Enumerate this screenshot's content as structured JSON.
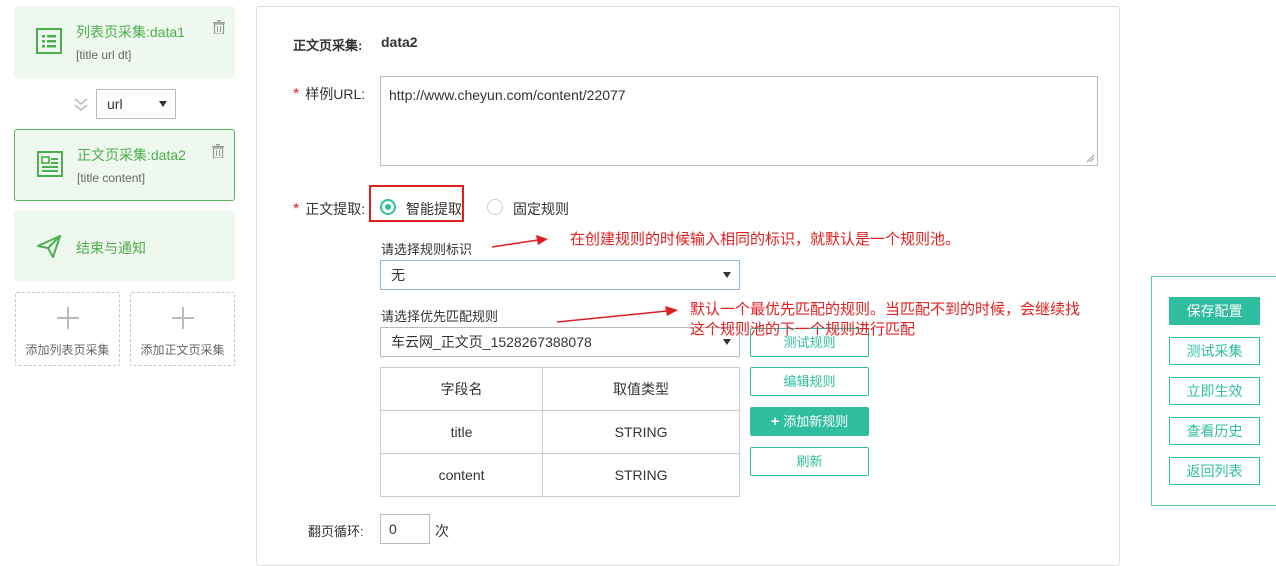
{
  "left_panel": {
    "step1": {
      "title": "列表页采集:data1",
      "sub": "[title url dt]"
    },
    "connector": {
      "selected": "url"
    },
    "step2": {
      "title": "正文页采集:data2",
      "sub": "[title content]"
    },
    "step3": {
      "title": "结束与通知"
    },
    "add_list": "添加列表页采集",
    "add_content": "添加正文页采集"
  },
  "form": {
    "header_label": "正文页采集:",
    "header_value": "data2",
    "req_mark": "*",
    "url_label": "样例URL:",
    "url_value": "http://www.cheyun.com/content/22077",
    "extract_label": "正文提取:",
    "radio_smart": "智能提取",
    "radio_fixed": "固定规则",
    "rule_tag_label": "请选择规则标识",
    "rule_tag_value": "无",
    "priority_label": "请选择优先匹配规则",
    "priority_value": "车云网_正文页_1528267388078",
    "table": {
      "headers": [
        "字段名",
        "取值类型"
      ],
      "rows": [
        [
          "title",
          "STRING"
        ],
        [
          "content",
          "STRING"
        ]
      ]
    },
    "buttons": {
      "test_rule": "测试规则",
      "edit_rule": "编辑规则",
      "add_rule": "添加新规则",
      "refresh": "刷新"
    },
    "pager_label": "翻页循环:",
    "pager_value": "0",
    "pager_unit": "次"
  },
  "annotations": {
    "a1": "在创建规则的时候输入相同的标识，就默认是一个规则池。",
    "a2_line1": "默认一个最优先匹配的规则。当匹配不到的时候，会继续找",
    "a2_line2": "这个规则池的下一个规则进行匹配"
  },
  "actions": {
    "save": "保存配置",
    "test": "测试采集",
    "apply": "立即生效",
    "history": "查看历史",
    "back": "返回列表"
  },
  "colors": {
    "accent": "#2fbfa0",
    "green": "#4cae4c",
    "annotation": "#e02020"
  }
}
